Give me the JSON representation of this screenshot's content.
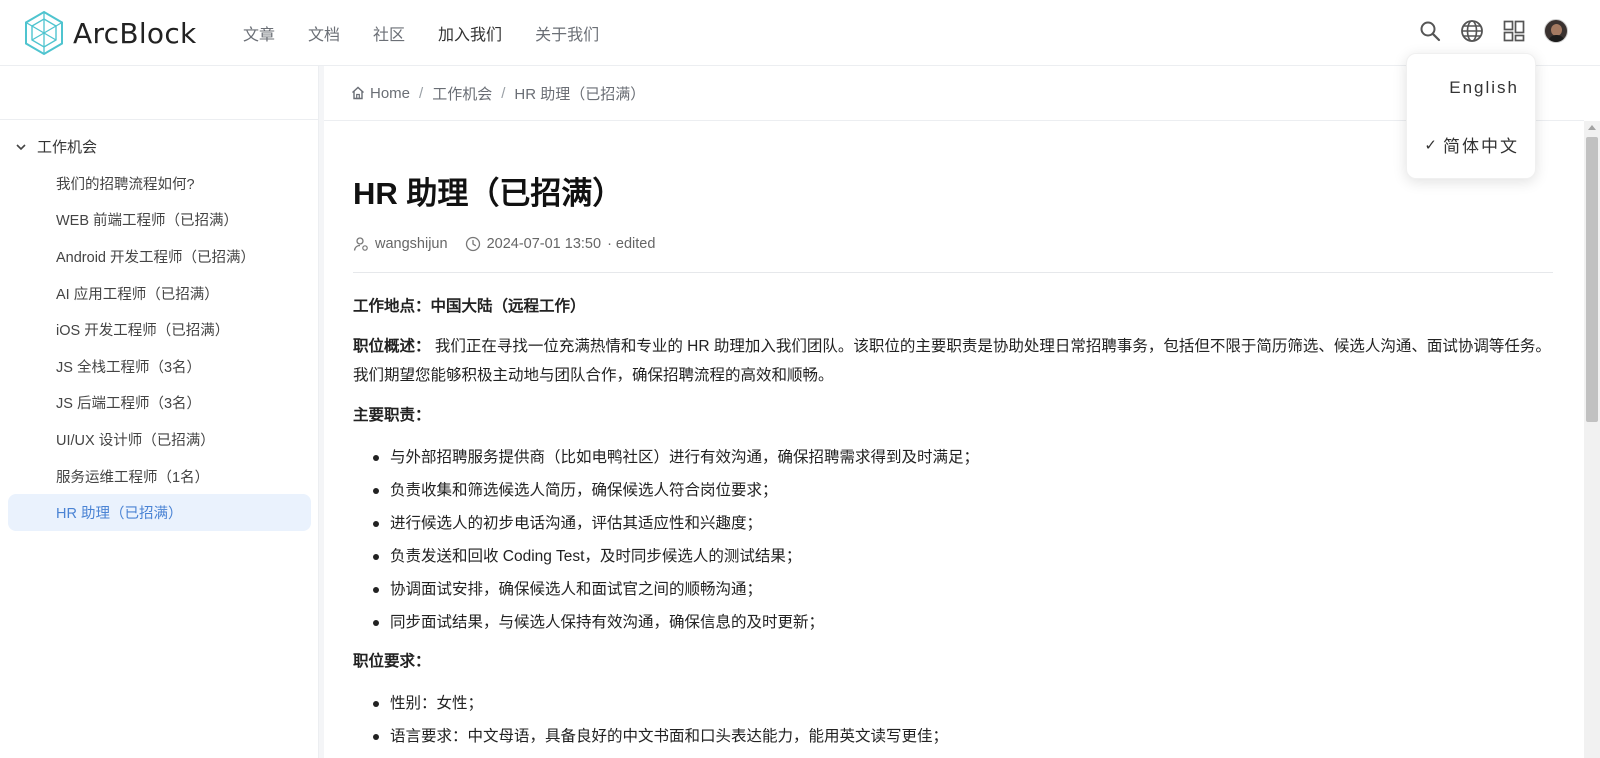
{
  "header": {
    "logo_text": "ArcBlock",
    "nav": [
      "文章",
      "文档",
      "社区",
      "加入我们",
      "关于我们"
    ],
    "active_nav_index": 3,
    "icons": [
      "search-icon",
      "globe-icon",
      "apps-grid-icon",
      "user-avatar"
    ]
  },
  "language_menu": {
    "items": [
      "English",
      "简体中文"
    ],
    "selected": "简体中文"
  },
  "sidebar": {
    "group_label": "工作机会",
    "items": [
      "我们的招聘流程如何?",
      "WEB 前端工程师（已招满）",
      "Android 开发工程师（已招满）",
      "AI 应用工程师（已招满）",
      "iOS 开发工程师（已招满）",
      "JS 全栈工程师（3名）",
      "JS 后端工程师（3名）",
      "UI/UX 设计师（已招满）",
      "服务运维工程师（1名）",
      "HR 助理（已招满）"
    ],
    "active_index": 9
  },
  "breadcrumb": {
    "home": "Home",
    "sep": "/",
    "level1": "工作机会",
    "level2": "HR 助理（已招满）"
  },
  "article": {
    "title": "HR 助理（已招满）",
    "author": "wangshijun",
    "date": "2024-07-01 13:50",
    "edited": "· edited",
    "location_label": "工作地点：中国大陆（远程工作）",
    "overview_label": "职位概述：",
    "overview_text": " 我们正在寻找一位充满热情和专业的 HR 助理加入我们团队。该职位的主要职责是协助处理日常招聘事务，包括但不限于简历筛选、候选人沟通、面试协调等任务。我们期望您能够积极主动地与团队合作，确保招聘流程的高效和顺畅。",
    "duties_label": "主要职责：",
    "duties": [
      "与外部招聘服务提供商（比如电鸭社区）进行有效沟通，确保招聘需求得到及时满足；",
      "负责收集和筛选候选人简历，确保候选人符合岗位要求；",
      "进行候选人的初步电话沟通，评估其适应性和兴趣度；",
      "负责发送和回收 Coding Test，及时同步候选人的测试结果；",
      "协调面试安排，确保候选人和面试官之间的顺畅沟通；",
      "同步面试结果，与候选人保持有效沟通，确保信息的及时更新；"
    ],
    "requirements_label": "职位要求：",
    "requirements": [
      "性别：女性；",
      "语言要求：中文母语，具备良好的中文书面和口头表达能力，能用英文读写更佳；"
    ]
  }
}
